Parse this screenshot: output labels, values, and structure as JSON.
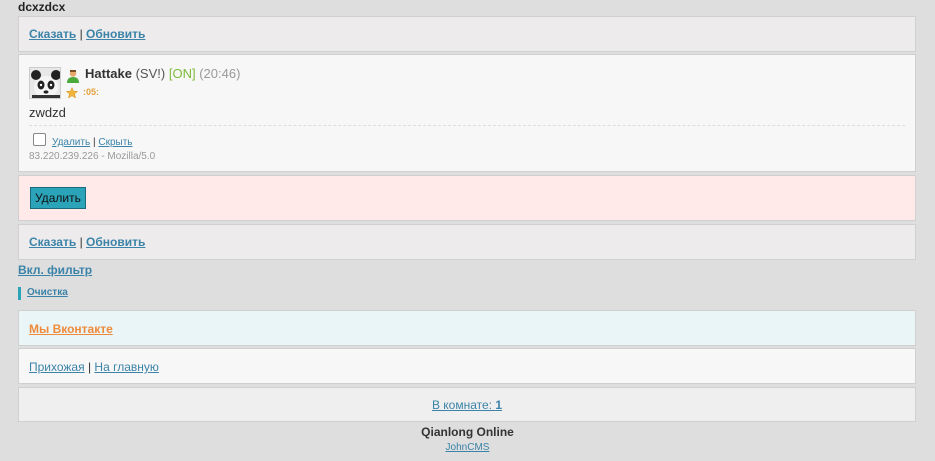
{
  "page": {
    "title": "dcxzdcx"
  },
  "top_bar": {
    "say": "Сказать",
    "sep": "|",
    "refresh": "Обновить"
  },
  "post": {
    "username": "Hattake",
    "tag": "(SV!)",
    "status": "[ON]",
    "time": "(20:46)",
    "rank": ":05:",
    "message": "zwdzd",
    "delete_link": "Удалить",
    "sep": "|",
    "hide_link": "Скрыть",
    "ip_ua": "83.220.239.226 - Mozilla/5.0"
  },
  "delete_panel": {
    "button": "Удалить"
  },
  "bottom_bar": {
    "say": "Сказать",
    "sep": "|",
    "refresh": "Обновить"
  },
  "filter": {
    "label": "Вкл. фильтр"
  },
  "clean": {
    "label": "Очистка"
  },
  "vk": {
    "label": "Мы Вконтакте"
  },
  "nav": {
    "hall": "Прихожая",
    "sep": "|",
    "home": "На главную"
  },
  "room": {
    "label": "В комнате:",
    "count": "1"
  },
  "footer": {
    "site": "Qianlong Online",
    "engine": "JohnCMS"
  },
  "colors": {
    "accent": "#2ba3b9",
    "link": "#3b83a8",
    "online": "#7dbb3a",
    "vk": "#f08a3b"
  }
}
